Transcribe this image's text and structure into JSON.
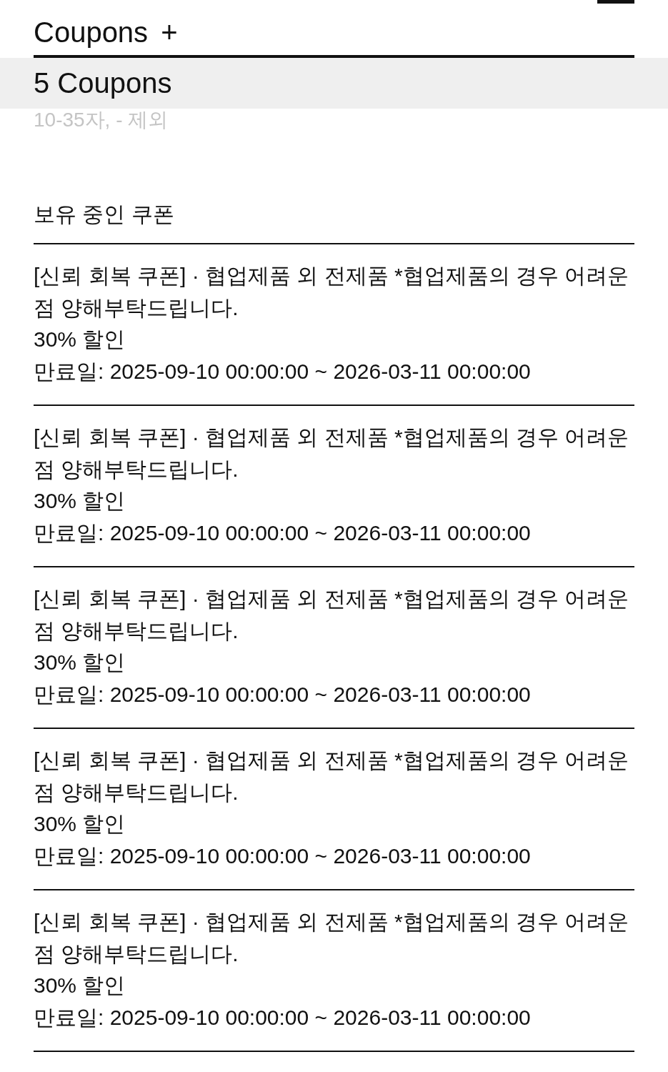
{
  "header": {
    "title": "Coupons",
    "add_label": "+"
  },
  "count_bar": {
    "label": "5 Coupons"
  },
  "hint": "10-35자, - 제외",
  "section_title": "보유 중인 쿠폰",
  "coupons": [
    {
      "title": "[신뢰 회복 쿠폰] · 협업제품 외 전제품 *협업제품의 경우 어려운 점 양해부탁드립니다.",
      "discount": "30% 할인",
      "expiry": "만료일: 2025-09-10 00:00:00 ~ 2026-03-11 00:00:00"
    },
    {
      "title": "[신뢰 회복 쿠폰] · 협업제품 외 전제품 *협업제품의 경우 어려운 점 양해부탁드립니다.",
      "discount": "30% 할인",
      "expiry": "만료일: 2025-09-10 00:00:00 ~ 2026-03-11 00:00:00"
    },
    {
      "title": "[신뢰 회복 쿠폰] · 협업제품 외 전제품 *협업제품의 경우 어려운 점 양해부탁드립니다.",
      "discount": "30% 할인",
      "expiry": "만료일: 2025-09-10 00:00:00 ~ 2026-03-11 00:00:00"
    },
    {
      "title": "[신뢰 회복 쿠폰] · 협업제품 외 전제품 *협업제품의 경우 어려운 점 양해부탁드립니다.",
      "discount": "30% 할인",
      "expiry": "만료일: 2025-09-10 00:00:00 ~ 2026-03-11 00:00:00"
    },
    {
      "title": "[신뢰 회복 쿠폰] · 협업제품 외 전제품 *협업제품의 경우 어려운 점 양해부탁드립니다.",
      "discount": "30% 할인",
      "expiry": "만료일: 2025-09-10 00:00:00 ~ 2026-03-11 00:00:00"
    }
  ]
}
